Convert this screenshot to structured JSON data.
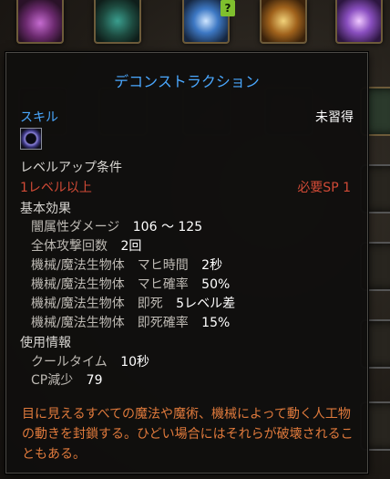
{
  "top_bar": {
    "icons": [
      "flower-orb-icon",
      "tree-figure-icon",
      "swirl-orb-icon",
      "golden-emblem-icon",
      "lightning-icon"
    ],
    "badge": "?"
  },
  "tooltip": {
    "title": "デコンストラクション",
    "skill_label": "スキル",
    "status": "未習得",
    "levelup_header": "レベルアップ条件",
    "level_req": "1レベル以上",
    "sp_req": "必要SP 1",
    "effects_header": "基本効果",
    "effects": [
      {
        "name": "闇属性ダメージ",
        "value": "106 ～ 125"
      },
      {
        "name": "全体攻撃回数",
        "value": "2回"
      },
      {
        "name": "機械/魔法生物体　マヒ時間",
        "value": "2秒"
      },
      {
        "name": "機械/魔法生物体　マヒ確率",
        "value": "50%"
      },
      {
        "name": "機械/魔法生物体　即死",
        "value": "5レベル差"
      },
      {
        "name": "機械/魔法生物体　即死確率",
        "value": "15%"
      }
    ],
    "usage_header": "使用情報",
    "usage": [
      {
        "name": "クールタイム",
        "value": "10秒"
      },
      {
        "name": "CP減少",
        "value": "79"
      }
    ],
    "description": "目に見えるすべての魔法や魔術、機械によって動く人工物の動きを封鎖する。ひどい場合にはそれらが破壊されることもある。"
  },
  "colors": {
    "title": "#4aa8ff",
    "requirement": "#d14a36",
    "description": "#e07a3c",
    "panel_bg": "#100f0e"
  }
}
